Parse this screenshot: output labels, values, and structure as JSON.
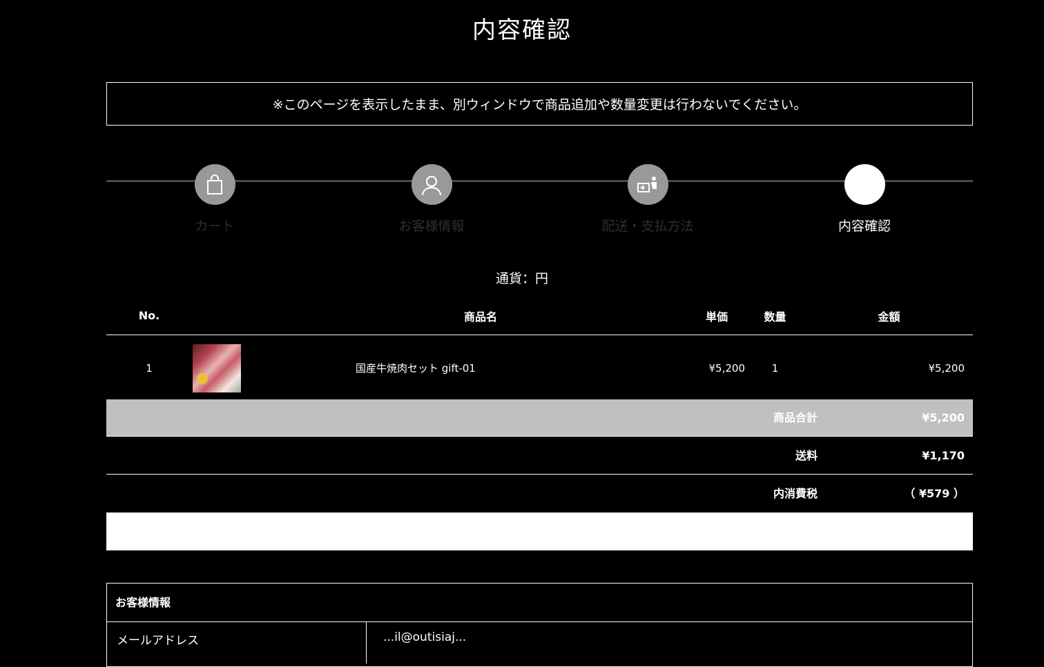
{
  "page": {
    "title": "内容確認",
    "notice": "※このページを表示したまま、別ウィンドウで商品追加や数量変更は行わないでください。"
  },
  "steps": [
    {
      "label": "カート",
      "icon": "shopping-bag-icon",
      "active": false
    },
    {
      "label": "お客様情報",
      "icon": "user-icon",
      "active": false
    },
    {
      "label": "配送・支払方法",
      "icon": "delivery-icon",
      "active": false
    },
    {
      "label": "内容確認",
      "icon": "",
      "active": true
    }
  ],
  "currency": "通貨：円",
  "table": {
    "headers": {
      "no": "No.",
      "name": "商品名",
      "unit_price": "単価",
      "qty": "数量",
      "amount": "金額"
    },
    "rows": [
      {
        "no": "1",
        "name": "国産牛焼肉セット gift-01",
        "unit_price": "¥5,200",
        "qty": "1",
        "amount": "¥5,200"
      }
    ]
  },
  "summary": {
    "subtotal_label": "商品合計",
    "subtotal_value": "¥5,200",
    "shipping_label": "送料",
    "shipping_value": "¥1,170",
    "tax_label": "内消費税",
    "tax_value": "（ ¥579 ）"
  },
  "customer": {
    "title": "お客様情報",
    "email_label": "メールアドレス",
    "email_value": "...il@outisiaj..."
  },
  "colors": {
    "background": "#000000",
    "subtotal_bg": "#c0c0c0",
    "step_inactive": "#999999"
  }
}
